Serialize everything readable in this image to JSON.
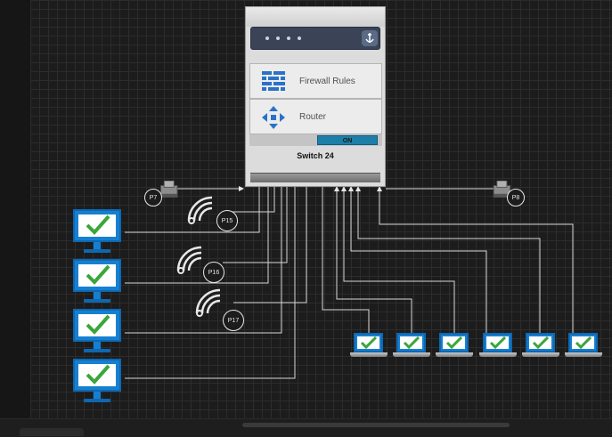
{
  "rack": {
    "maker_label": "",
    "modules": [
      {
        "id": "firewall",
        "label": "Firewall Rules",
        "icon": "firewall-icon"
      },
      {
        "id": "router",
        "label": "Router",
        "icon": "router-icon"
      }
    ],
    "status": "ON",
    "title": "Switch 24"
  },
  "ports": {
    "left_gateway": "P7",
    "right_gateway": "P8",
    "wifi_1": "P15",
    "wifi_2": "P16",
    "wifi_3": "P17"
  },
  "colors": {
    "background": "#1c1c1c",
    "grid": "#2c2c2c",
    "wire": "#e0e0e0",
    "device_blue": "#1580d2",
    "check_green": "#3aa63a",
    "status_on": "#1d7fa8"
  },
  "devices": {
    "monitors": [
      "monitor-1",
      "monitor-2",
      "monitor-3",
      "monitor-4"
    ],
    "laptops": [
      "laptop-1",
      "laptop-2",
      "laptop-3",
      "laptop-4",
      "laptop-5",
      "laptop-6"
    ]
  }
}
